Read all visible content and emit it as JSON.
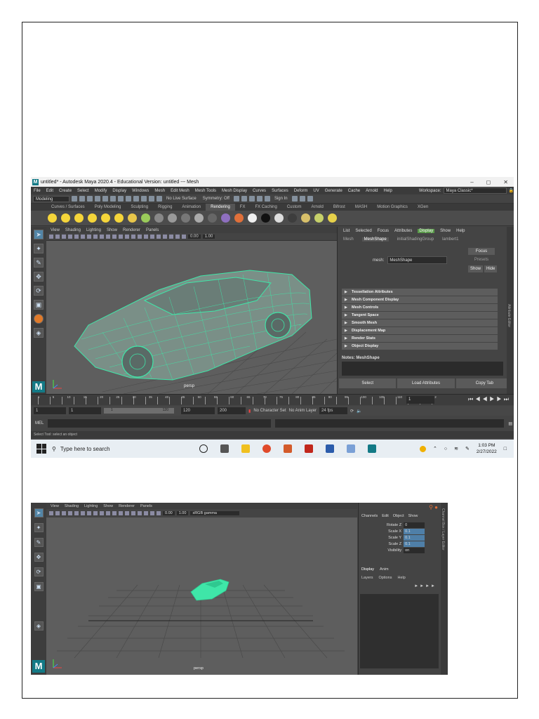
{
  "shot1": {
    "title": "untitled* - Autodesk Maya 2020.4 - Educational Version: untitled  ---  Mesh",
    "window_controls": [
      "–",
      "◻",
      "✕"
    ],
    "menus": [
      "File",
      "Edit",
      "Create",
      "Select",
      "Modify",
      "Display",
      "Windows",
      "Mesh",
      "Edit Mesh",
      "Mesh Tools",
      "Mesh Display",
      "Curves",
      "Surfaces",
      "Deform",
      "UV",
      "Generate",
      "Cache",
      "Arnold",
      "Help"
    ],
    "workspace_label": "Workspace:",
    "workspace_value": "Maya Classic*",
    "mode_menu": "Modeling",
    "live_surface": "No Live Surface",
    "symmetry": "Symmetry: Off",
    "sign_in": "Sign In",
    "shelf_tabs": [
      "Curves / Surfaces",
      "Poly Modeling",
      "Sculpting",
      "Rigging",
      "Animation",
      "Rendering",
      "FX",
      "FX Caching",
      "Custom",
      "Arnold",
      "Bifrost",
      "MASH",
      "Motion Graphics",
      "XGen"
    ],
    "active_shelf": "Rendering",
    "viewport_menus": [
      "View",
      "Shading",
      "Lighting",
      "Show",
      "Renderer",
      "Panels"
    ],
    "viewport_exposure": "0.00",
    "viewport_gamma": "1.00",
    "camera_label": "persp",
    "attr_menus": [
      "List",
      "Selected",
      "Focus",
      "Attributes",
      "Display",
      "Show",
      "Help"
    ],
    "attr_menu_highlight": "Display",
    "attr_tabs": [
      "Mesh",
      "MeshShape",
      "initialShadingGroup",
      "lambert1"
    ],
    "attr_active_tab": "MeshShape",
    "mesh_label": "mesh:",
    "mesh_value": "MeshShape",
    "focus_button": "Focus",
    "presets_button": "Presets",
    "show_button": "Show",
    "hide_button": "Hide",
    "attr_sections": [
      "Tessellation Attributes",
      "Mesh Component Display",
      "Mesh Controls",
      "Tangent Space",
      "Smooth Mesh",
      "Displacement Map",
      "Render Stats",
      "Object Display"
    ],
    "notes_label": "Notes: MeshShape",
    "bottom_buttons": [
      "Select",
      "Load Attributes",
      "Copy Tab"
    ],
    "time_ticks": [
      "1",
      "5",
      "10",
      "15",
      "20",
      "25",
      "30",
      "35",
      "40",
      "45",
      "50",
      "55",
      "60",
      "65",
      "70",
      "75",
      "80",
      "85",
      "90",
      "95",
      "100",
      "105",
      "110",
      "115",
      "12"
    ],
    "current_frame": "1",
    "range_start": "1",
    "range_start_2": "1",
    "range_inner_start": "1",
    "range_inner_end": "120",
    "range_end": "120",
    "range_end_2": "200",
    "character_set": "No Character Set",
    "anim_layer": "No Anim Layer",
    "fps": "24 fps",
    "mel_label": "MEL",
    "help_line": "Select Tool: select an object",
    "taskbar_search": "Type here to search",
    "clock_time": "1:03 PM",
    "clock_date": "2/27/2022",
    "side_tabs": "Attribute Editor"
  },
  "shot2": {
    "viewport_menus": [
      "View",
      "Shading",
      "Lighting",
      "Show",
      "Renderer",
      "Panels"
    ],
    "exposure": "0.00",
    "gamma": "1.00",
    "color_space": "sRGB gamma",
    "camera_label": "persp",
    "channel_menus": [
      "Channels",
      "Edit",
      "Object",
      "Show"
    ],
    "channel_rows": [
      {
        "label": "Rotate Z",
        "value": "0",
        "hl": false
      },
      {
        "label": "Scale X",
        "value": "0.1",
        "hl": true
      },
      {
        "label": "Scale Y",
        "value": "0.1",
        "hl": true
      },
      {
        "label": "Scale Z",
        "value": "0.1",
        "hl": true
      },
      {
        "label": "Visibility",
        "value": "on",
        "hl": false
      }
    ],
    "display_tabs": [
      "Display",
      "Anim"
    ],
    "layer_menus": [
      "Layers",
      "Options",
      "Help"
    ],
    "side_tabs": "Channel Box / Layer Editor"
  },
  "colors": {
    "wireframe": "#3fe6a8",
    "maya_panel": "#444444",
    "viewport_bg": "#5e5e5e",
    "highlight": "#5285a6"
  }
}
